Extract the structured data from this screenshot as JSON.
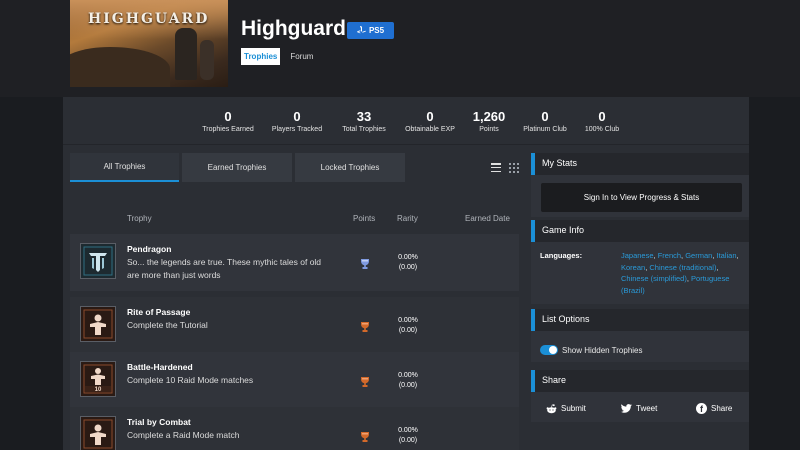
{
  "game": {
    "cover_logo": "HIGHGUARD",
    "title": "Highguard",
    "platform": "PS5"
  },
  "nav": [
    {
      "label": "Trophies",
      "active": true
    },
    {
      "label": "Forum",
      "active": false
    }
  ],
  "stats": [
    {
      "value": "0",
      "label": "Trophies Earned"
    },
    {
      "value": "0",
      "label": "Players Tracked"
    },
    {
      "value": "33",
      "label": "Total Trophies"
    },
    {
      "value": "0",
      "label": "Obtainable EXP"
    },
    {
      "value": "1,260",
      "label": "Points"
    },
    {
      "value": "0",
      "label": "Platinum Club"
    },
    {
      "value": "0",
      "label": "100% Club"
    }
  ],
  "tabs": [
    {
      "label": "All Trophies",
      "active": true
    },
    {
      "label": "Earned Trophies",
      "active": false
    },
    {
      "label": "Locked Trophies",
      "active": false
    }
  ],
  "columns": {
    "trophy": "Trophy",
    "points": "Points",
    "rarity": "Rarity",
    "earned": "Earned Date"
  },
  "trophies": [
    {
      "name": "Pendragon",
      "description": "So... the legends are true. These mythic tales of old are more than just words",
      "tier": "platinum",
      "tier_color": "#7f9ae0",
      "rarity_pct": "0.00%",
      "rarity_pts": "(0.00)",
      "icon": "highguard-emblem-icon"
    },
    {
      "name": "Rite of Passage",
      "description": "Complete the Tutorial",
      "tier": "bronze",
      "tier_color": "#d2692a",
      "rarity_pct": "0.00%",
      "rarity_pts": "(0.00)",
      "icon": "figure-icon"
    },
    {
      "name": "Battle-Hardened",
      "description": "Complete 10 Raid Mode matches",
      "tier": "bronze",
      "tier_color": "#d2692a",
      "rarity_pct": "0.00%",
      "rarity_pts": "(0.00)",
      "icon": "figure-ten-icon",
      "icon_text": "10"
    },
    {
      "name": "Trial by Combat",
      "description": "Complete a Raid Mode match",
      "tier": "bronze",
      "tier_color": "#d2692a",
      "rarity_pct": "0.00%",
      "rarity_pts": "(0.00)",
      "icon": "figure-icon"
    }
  ],
  "sidebar": {
    "my_stats": {
      "title": "My Stats",
      "signin_label": "Sign In to View Progress & Stats"
    },
    "game_info": {
      "title": "Game Info",
      "languages_label": "Languages:",
      "languages": [
        "Japanese",
        "French",
        "German",
        "Italian",
        "Korean",
        "Chinese (traditional)",
        "Chinese (simplified)",
        "Portuguese (Brazil)"
      ]
    },
    "list_options": {
      "title": "List Options",
      "toggle_label": "Show Hidden Trophies",
      "toggle_on": true
    },
    "share": {
      "title": "Share",
      "buttons": [
        {
          "label": "Submit",
          "icon": "reddit-icon"
        },
        {
          "label": "Tweet",
          "icon": "twitter-icon"
        },
        {
          "label": "Share",
          "icon": "facebook-icon"
        }
      ]
    }
  },
  "colors": {
    "accent": "#1b8fd6",
    "platform_badge": "#1f6fd1",
    "bronze": "#d2692a",
    "platinum": "#7f9ae0"
  }
}
